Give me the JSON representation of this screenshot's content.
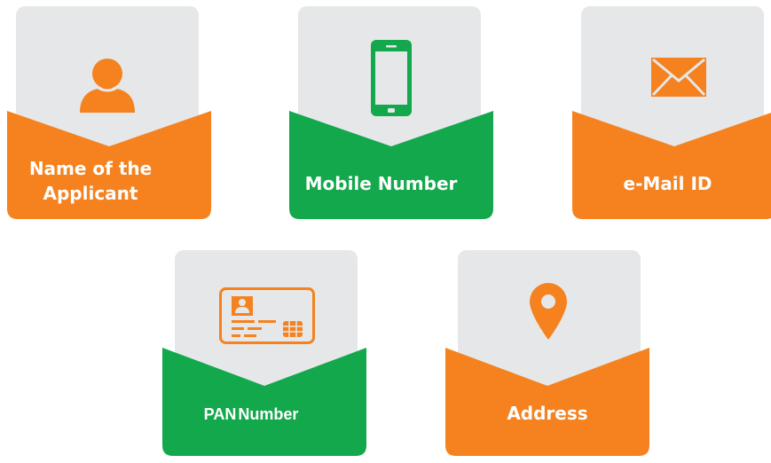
{
  "colors": {
    "orange": "#F5821F",
    "green": "#12A84B",
    "panel_gray": "#E6E7E8",
    "white": "#FFFFFF"
  },
  "cards": [
    {
      "id": "name",
      "label": "Name of the\nApplicant",
      "label_line1": "Name of the",
      "label_line2": "Applicant",
      "color": "orange",
      "icon": "user-icon"
    },
    {
      "id": "mobile",
      "label": "Mobile Number",
      "color": "green",
      "icon": "mobile-phone-icon"
    },
    {
      "id": "email",
      "label": "e-Mail ID",
      "color": "orange",
      "icon": "envelope-icon"
    },
    {
      "id": "pan",
      "label": "PAN Number",
      "label_part1": "PAN",
      "label_part2": "Number",
      "color": "green",
      "icon": "id-card-icon"
    },
    {
      "id": "address",
      "label": "Address",
      "color": "orange",
      "icon": "location-pin-icon"
    }
  ]
}
